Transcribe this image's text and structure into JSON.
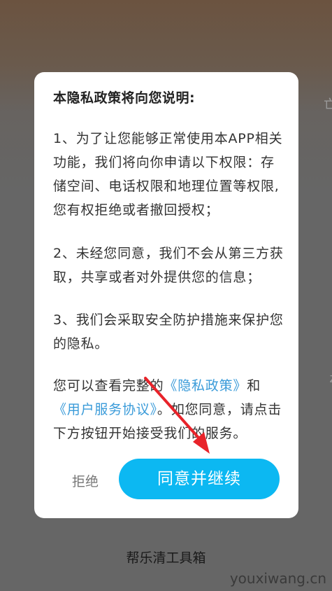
{
  "dialog": {
    "title": "本隐私政策将向您说明:",
    "para1": "1、为了让您能够正常使用本APP相关功能，我们将向你申请以下权限：存储空间、电话权限和地理位置等权限,您有权拒绝或者撤回授权；",
    "para2": "2、未经您同意，我们不会从第三方获取，共享或者对外提供您的信息；",
    "para3": "3、我们会采取安全防护措施来保护您的隐私。",
    "para4_prefix": "您可以查看完整的",
    "privacy_link": "《隐私政策》",
    "para4_and": "和",
    "agreement_link": "《用户服务协议》",
    "para4_suffix": "。如您同意，请点击下方按钮开始接受我们的服务。",
    "reject_label": "拒绝",
    "agree_label": "同意并继续"
  },
  "background": {
    "app_name": "帮乐清工具箱"
  },
  "watermark": "youxiwang.cn",
  "colors": {
    "accent": "#0cb8f2",
    "link": "#3a9bd9",
    "arrow": "#e8232a"
  }
}
